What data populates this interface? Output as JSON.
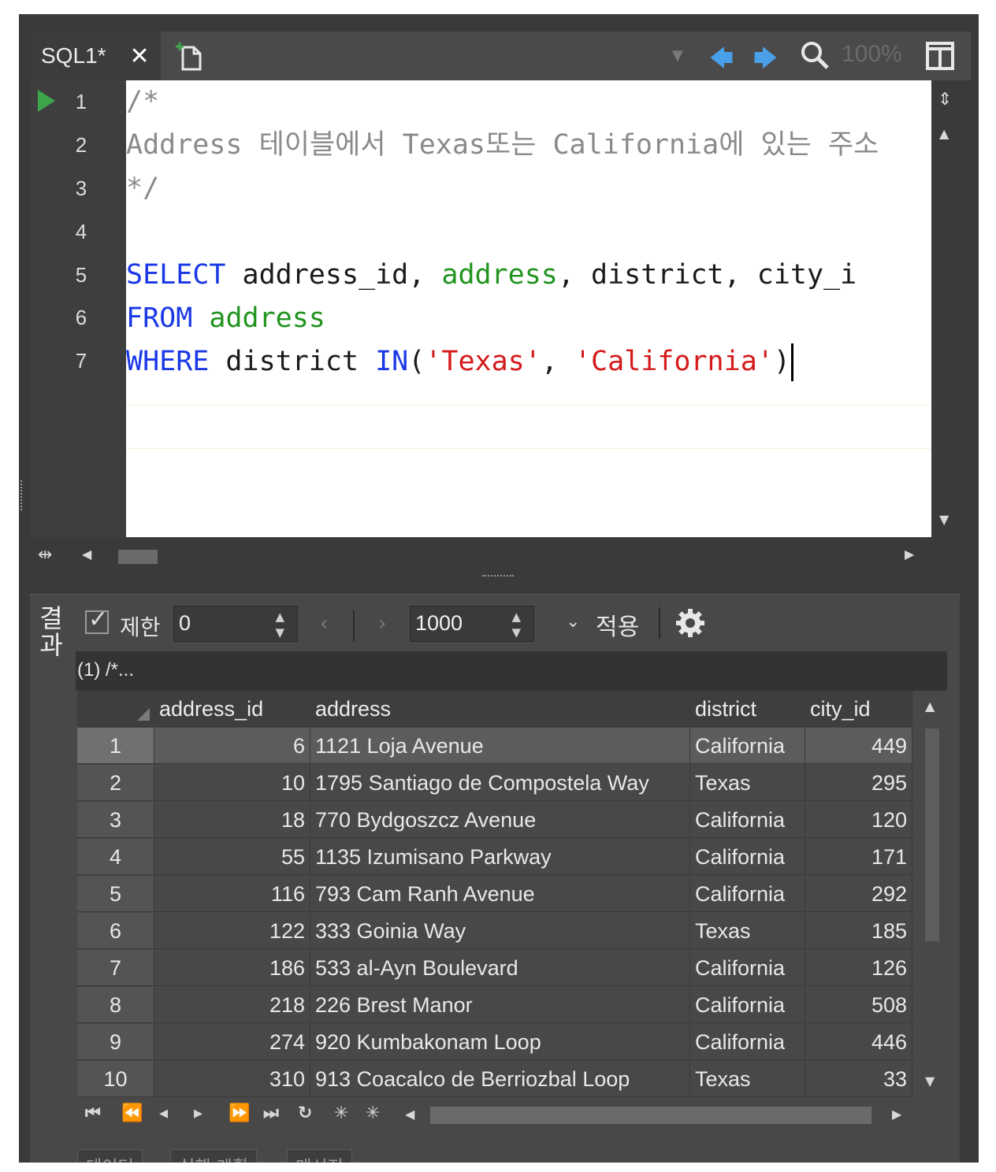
{
  "editor": {
    "tab_title": "SQL1*",
    "zoom": "100%",
    "line_numbers": [
      "1",
      "2",
      "3",
      "4",
      "5",
      "6",
      "7"
    ],
    "code": {
      "l1": "/*",
      "l2": "Address 테이블에서 Texas또는 California에 있는 주소",
      "l3": "*/",
      "l5_kw": "SELECT",
      "l5_a": " address_id, ",
      "l5_b": "address",
      "l5_c": ", district, city_i",
      "l6_kw": "FROM",
      "l6_a": " ",
      "l6_b": "address",
      "l7_kw": "WHERE",
      "l7_a": " district ",
      "l7_kw2": "IN",
      "l7_b": "(",
      "l7_s1": "'Texas'",
      "l7_c": ", ",
      "l7_s2": "'California'",
      "l7_d": ")"
    }
  },
  "results": {
    "side_tab": "결과",
    "limit_label": "제한",
    "offset_value": "0",
    "count_value": "1000",
    "apply_label": "적용",
    "resultset_title": "(1) /*...",
    "columns": [
      "address_id",
      "address",
      "district",
      "city_id"
    ],
    "rows": [
      {
        "n": "1",
        "address_id": "6",
        "address": "1121 Loja Avenue",
        "district": "California",
        "city_id": "449"
      },
      {
        "n": "2",
        "address_id": "10",
        "address": "1795 Santiago de Compostela Way",
        "district": "Texas",
        "city_id": "295"
      },
      {
        "n": "3",
        "address_id": "18",
        "address": "770 Bydgoszcz Avenue",
        "district": "California",
        "city_id": "120"
      },
      {
        "n": "4",
        "address_id": "55",
        "address": "1135 Izumisano Parkway",
        "district": "California",
        "city_id": "171"
      },
      {
        "n": "5",
        "address_id": "116",
        "address": "793 Cam Ranh Avenue",
        "district": "California",
        "city_id": "292"
      },
      {
        "n": "6",
        "address_id": "122",
        "address": "333 Goinia Way",
        "district": "Texas",
        "city_id": "185"
      },
      {
        "n": "7",
        "address_id": "186",
        "address": "533 al-Ayn Boulevard",
        "district": "California",
        "city_id": "126"
      },
      {
        "n": "8",
        "address_id": "218",
        "address": "226 Brest Manor",
        "district": "California",
        "city_id": "508"
      },
      {
        "n": "9",
        "address_id": "274",
        "address": "920 Kumbakonam Loop",
        "district": "California",
        "city_id": "446"
      },
      {
        "n": "10",
        "address_id": "310",
        "address": "913 Coacalco de Berriozbal Loop",
        "district": "Texas",
        "city_id": "33"
      }
    ],
    "bottom_tabs": [
      "데이터",
      "실행 계획",
      "메시지"
    ]
  },
  "icons": {
    "run_marker": "play-icon",
    "new_tab": "new-document-icon",
    "prev": "arrow-left-icon",
    "next": "arrow-right-icon",
    "zoom": "magnifier-icon",
    "layout": "split-layout-icon",
    "settings": "gear-icon"
  },
  "colors": {
    "keyword": "#1a38e6",
    "identifier": "#21941f",
    "string": "#d51a1a",
    "comment": "#8a8a8a",
    "run_marker": "#3da64a",
    "nav_arrows": "#4aa0e8"
  }
}
